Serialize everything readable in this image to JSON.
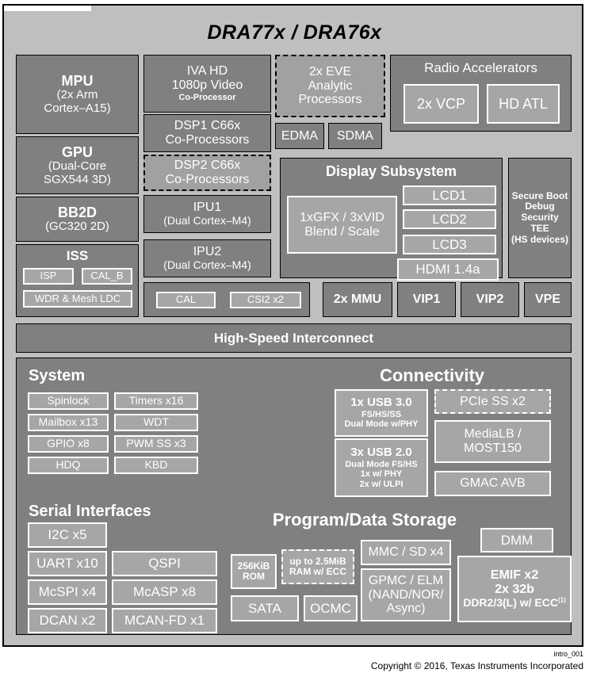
{
  "device": {
    "title": "DRA77x / DRA76x"
  },
  "footer": {
    "code": "intro_001",
    "copyright": "Copyright © 2016, Texas Instruments Incorporated"
  },
  "processors": {
    "mpu": {
      "name": "MPU",
      "line2": "(2x Arm",
      "line3": "Cortex–A15)"
    },
    "gpu": {
      "name": "GPU",
      "line2": "(Dual-Core",
      "line3": "SGX544 3D)"
    },
    "bb2d": {
      "name": "BB2D",
      "line2": "(GC320 2D)"
    },
    "iss": {
      "name": "ISP",
      "title": "ISS",
      "isp": "ISP",
      "cal_b": "CAL_B",
      "wdr": "WDR & Mesh LDC"
    },
    "iva": {
      "line1": "IVA HD",
      "line2": "1080p Video",
      "line3": "Co-Processor"
    },
    "dsp1": {
      "line1": "DSP1 C66x",
      "line2": "Co-Processors"
    },
    "dsp2": {
      "line1": "DSP2 C66x",
      "line2": "Co-Processors"
    },
    "ipu1": {
      "line1": "IPU1",
      "line2": "(Dual Cortex–M4)"
    },
    "ipu2": {
      "line1": "IPU2",
      "line2": "(Dual Cortex–M4)"
    },
    "eve": {
      "line1": "2x EVE",
      "line2": "Analytic",
      "line3": "Processors"
    },
    "edma": "EDMA",
    "sdma": "SDMA"
  },
  "radio": {
    "title": "Radio Accelerators",
    "vcp": "2x VCP",
    "hdatl": "HD ATL"
  },
  "camera_row": {
    "cal": "CAL",
    "csi2": "CSI2 x2"
  },
  "display": {
    "title": "Display Subsystem",
    "blend": {
      "line1": "1xGFX / 3xVID",
      "line2": "Blend / Scale"
    },
    "outputs": [
      "LCD1",
      "LCD2",
      "LCD3",
      "HDMI 1.4a"
    ]
  },
  "security": {
    "lines": [
      "Secure Boot",
      "Debug",
      "Security",
      "TEE",
      "(HS devices)"
    ]
  },
  "video_row": {
    "mmu": "2x MMU",
    "vip1": "VIP1",
    "vip2": "VIP2",
    "vpe": "VPE"
  },
  "interconnect": {
    "label": "High-Speed Interconnect"
  },
  "system": {
    "title": "System",
    "items": [
      "Spinlock",
      "Timers x16",
      "Mailbox x13",
      "WDT",
      "GPIO x8",
      "PWM SS x3",
      "HDQ",
      "KBD"
    ]
  },
  "serial": {
    "title": "Serial Interfaces",
    "i2c": "I2C x5",
    "uart": "UART x10",
    "qspi": "QSPI",
    "mcspi": "McSPI x4",
    "mcasp": "McASP x8",
    "dcan": "DCAN x2",
    "mcan": "MCAN-FD x1"
  },
  "connectivity": {
    "title": "Connectivity",
    "usb3": {
      "line1": "1x USB 3.0",
      "line2": "FS/HS/SS",
      "line3": "Dual Mode w/PHY"
    },
    "usb2": {
      "line1": "3x USB 2.0",
      "line2": "Dual Mode FS/HS",
      "line3": "1x w/ PHY",
      "line4": "2x w/ ULPI"
    },
    "pcie": "PCIe SS x2",
    "medialb": {
      "line1": "MediaLB /",
      "line2": "MOST150"
    },
    "gmac": "GMAC AVB"
  },
  "storage": {
    "title": "Program/Data Storage",
    "rom": {
      "line1": "256KiB",
      "line2": "ROM"
    },
    "ram": {
      "line1": "up to 2.5MiB",
      "line2": "RAM w/ ECC"
    },
    "sata": "SATA",
    "ocmc": "OCMC",
    "mmc": "MMC / SD x4",
    "gpmc": {
      "line1": "GPMC / ELM",
      "line2": "(NAND/NOR/",
      "line3": "Async)"
    },
    "dmm": "DMM",
    "emif": {
      "line1": "EMIF x2",
      "line2": "2x 32b",
      "line3": "DDR2/3(L) w/ ECC",
      "sup": "(1)"
    }
  },
  "colors": {
    "background": "#bfbfbf",
    "block": "#808080",
    "inner": "#a6a6a6",
    "text": "#ffffff",
    "border": "#000000"
  }
}
